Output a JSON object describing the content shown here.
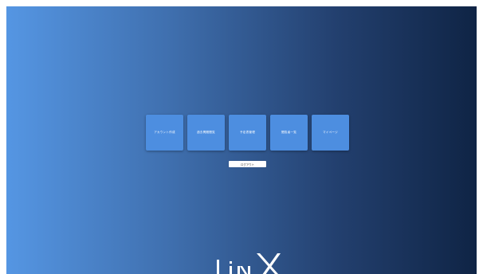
{
  "menu": {
    "items": [
      {
        "label": "アカウント作成"
      },
      {
        "label": "過去問題閲覧"
      },
      {
        "label": "予定表管理"
      },
      {
        "label": "閲覧者一覧"
      },
      {
        "label": "マイページ"
      }
    ]
  },
  "logout": {
    "label": "ログアウト"
  },
  "logo": {
    "text": "LinX"
  },
  "colors": {
    "background_start": "#5596e3",
    "background_end": "#0f2445",
    "tile": "#4d8ee0",
    "logout_bg": "#ffffff"
  }
}
